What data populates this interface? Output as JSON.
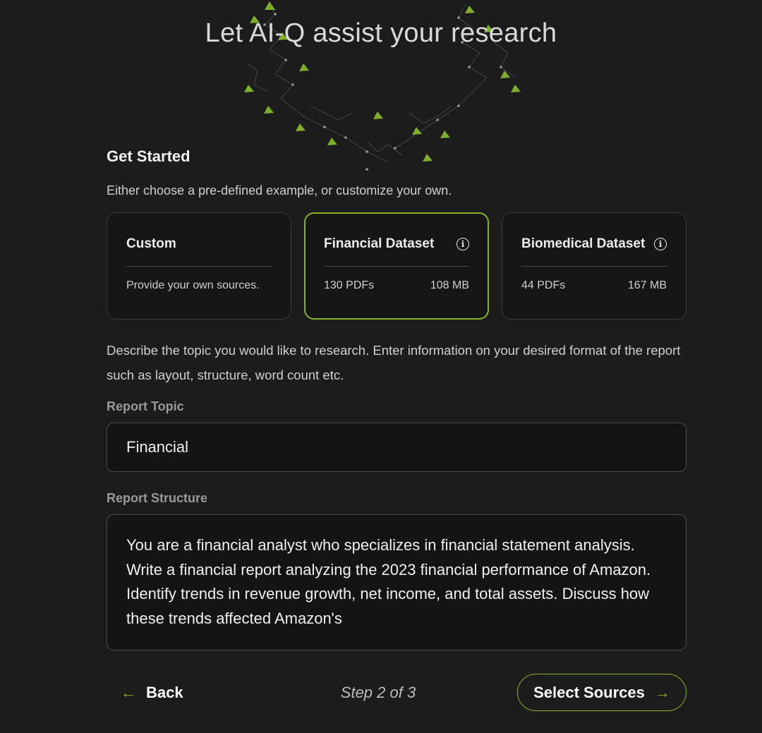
{
  "header": {
    "title": "Let AI-Q assist your research"
  },
  "get_started": {
    "title": "Get Started",
    "subtitle": "Either choose a pre-defined example, or customize your own."
  },
  "cards": [
    {
      "title": "Custom",
      "description": "Provide your own sources.",
      "selected": false
    },
    {
      "title": "Financial Dataset",
      "count": "130 PDFs",
      "size": "108 MB",
      "selected": true,
      "icon": "info-icon"
    },
    {
      "title": "Biomedical Dataset",
      "count": "44 PDFs",
      "size": "167 MB",
      "selected": false,
      "icon": "info-icon"
    }
  ],
  "describe_text": "Describe the topic you would like to research. Enter information on your desired format of the report such as layout, structure, word count etc.",
  "report_topic": {
    "label": "Report Topic",
    "value": "Financial"
  },
  "report_structure": {
    "label": "Report Structure",
    "value": "You are a financial analyst who specializes in financial statement analysis. Write a financial report analyzing the 2023 financial performance of Amazon. Identify trends in revenue growth, net income, and total assets. Discuss how these trends affected Amazon's"
  },
  "footer": {
    "back_label": "Back",
    "back_icon": "arrow-left-icon",
    "step_text": "Step 2 of 3",
    "next_label": "Select Sources",
    "next_icon": "arrow-right-icon"
  },
  "colors": {
    "background": "#1c1c1c",
    "accent": "#86b32a"
  }
}
